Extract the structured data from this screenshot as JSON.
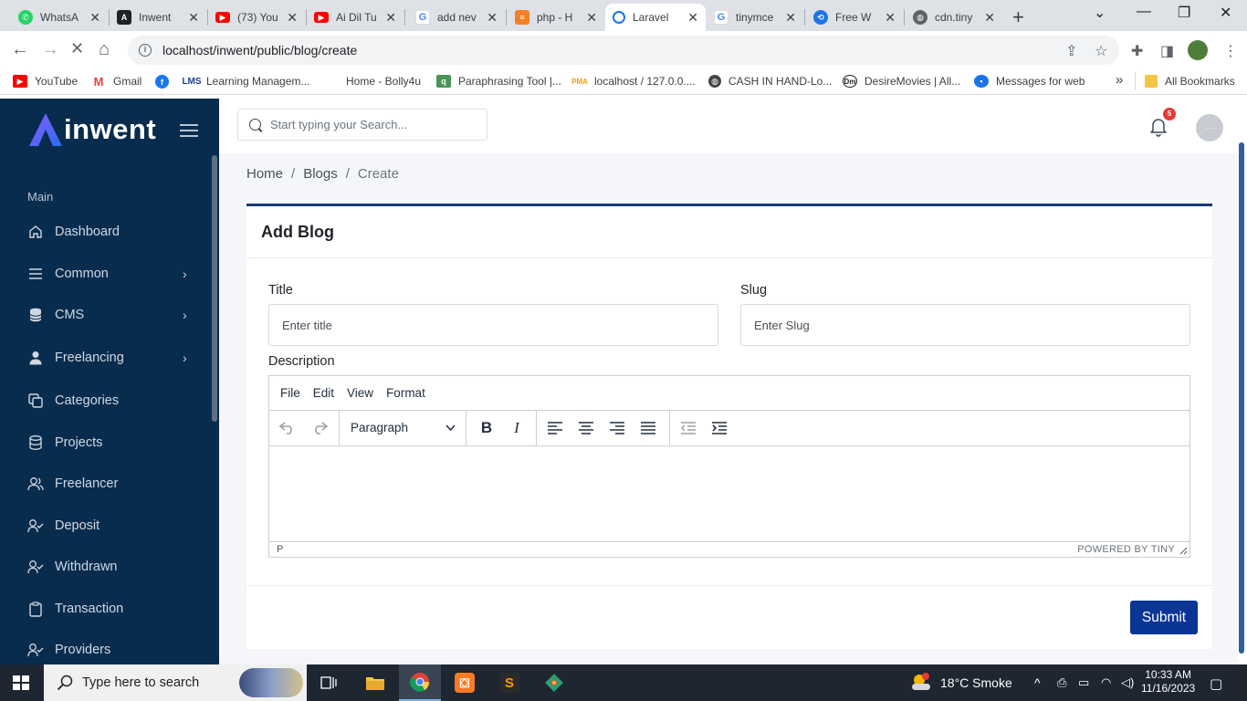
{
  "browser": {
    "tabs": [
      {
        "title": "WhatsA",
        "icon": "whatsapp-icon",
        "color": "#25d366"
      },
      {
        "title": "Inwent",
        "icon": "angular-icon",
        "color": "#202124"
      },
      {
        "title": "(73) You",
        "icon": "youtube-icon",
        "color": "#ff0000"
      },
      {
        "title": "Ai Dil Tu",
        "icon": "youtube-icon",
        "color": "#ff0000"
      },
      {
        "title": "add nev",
        "icon": "google-icon",
        "color": "#4285f4"
      },
      {
        "title": "php - H",
        "icon": "stackoverflow-icon",
        "color": "#f48024"
      },
      {
        "title": "Laravel",
        "icon": "loading-icon",
        "color": "#1a73e8"
      },
      {
        "title": "tinymce",
        "icon": "google-icon",
        "color": "#4285f4"
      },
      {
        "title": "Free W",
        "icon": "shield-icon",
        "color": "#1a73e8"
      },
      {
        "title": "cdn.tiny",
        "icon": "globe-icon",
        "color": "#5f6368"
      }
    ],
    "url": "localhost/inwent/public/blog/create",
    "bookmarks": [
      {
        "label": "YouTube",
        "icon": "youtube-icon",
        "color": "#ff0000"
      },
      {
        "label": "Gmail",
        "icon": "gmail-icon",
        "color": "#ea4335"
      },
      {
        "label": "",
        "icon": "facebook-icon",
        "color": "#1877f2"
      },
      {
        "label": "Learning Managem...",
        "icon": "lms-icon",
        "color": "#1d3d8f"
      },
      {
        "label": "Home - Bolly4u",
        "icon": "",
        "color": ""
      },
      {
        "label": "Paraphrasing Tool |...",
        "icon": "quillbot-icon",
        "color": "#499557"
      },
      {
        "label": "localhost / 127.0.0....",
        "icon": "phpmyadmin-icon",
        "color": "#f89c0e"
      },
      {
        "label": "CASH IN HAND-Lo...",
        "icon": "globe-icon",
        "color": "#444"
      },
      {
        "label": "DesireMovies | All...",
        "icon": "dm-icon",
        "color": "#222"
      },
      {
        "label": "Messages for web",
        "icon": "messages-icon",
        "color": "#1a73e8"
      }
    ],
    "bookmarks_more": "»",
    "all_bookmarks": "All Bookmarks"
  },
  "sidebar": {
    "brand": "inwent",
    "section": "Main",
    "items": [
      {
        "label": "Dashboard",
        "icon": "home-icon",
        "submenu": false
      },
      {
        "label": "Common",
        "icon": "list-icon",
        "submenu": true
      },
      {
        "label": "CMS",
        "icon": "database-icon",
        "submenu": true
      },
      {
        "label": "Freelancing",
        "icon": "user-icon",
        "submenu": true
      },
      {
        "label": "Categories",
        "icon": "copy-icon",
        "submenu": false
      },
      {
        "label": "Projects",
        "icon": "database-icon",
        "submenu": false
      },
      {
        "label": "Freelancer",
        "icon": "users-icon",
        "submenu": false
      },
      {
        "label": "Deposit",
        "icon": "user-check-icon",
        "submenu": false
      },
      {
        "label": "Withdrawn",
        "icon": "user-check-icon",
        "submenu": false
      },
      {
        "label": "Transaction",
        "icon": "clipboard-icon",
        "submenu": false
      },
      {
        "label": "Providers",
        "icon": "user-check-icon",
        "submenu": false
      }
    ]
  },
  "topbar": {
    "search_placeholder": "Start typing your Search...",
    "notification_count": "5"
  },
  "breadcrumb": [
    "Home",
    "Blogs",
    "Create"
  ],
  "form": {
    "card_title": "Add Blog",
    "title_label": "Title",
    "title_placeholder": "Enter title",
    "slug_label": "Slug",
    "slug_placeholder": "Enter Slug",
    "description_label": "Description",
    "editor": {
      "menus": [
        "File",
        "Edit",
        "View",
        "Format"
      ],
      "block_format": "Paragraph",
      "path": "P",
      "branding": "POWERED BY TINY"
    },
    "submit_label": "Submit"
  },
  "taskbar": {
    "search_placeholder": "Type here to search",
    "weather": "18°C  Smoke",
    "time": "10:33 AM",
    "date": "11/16/2023"
  }
}
